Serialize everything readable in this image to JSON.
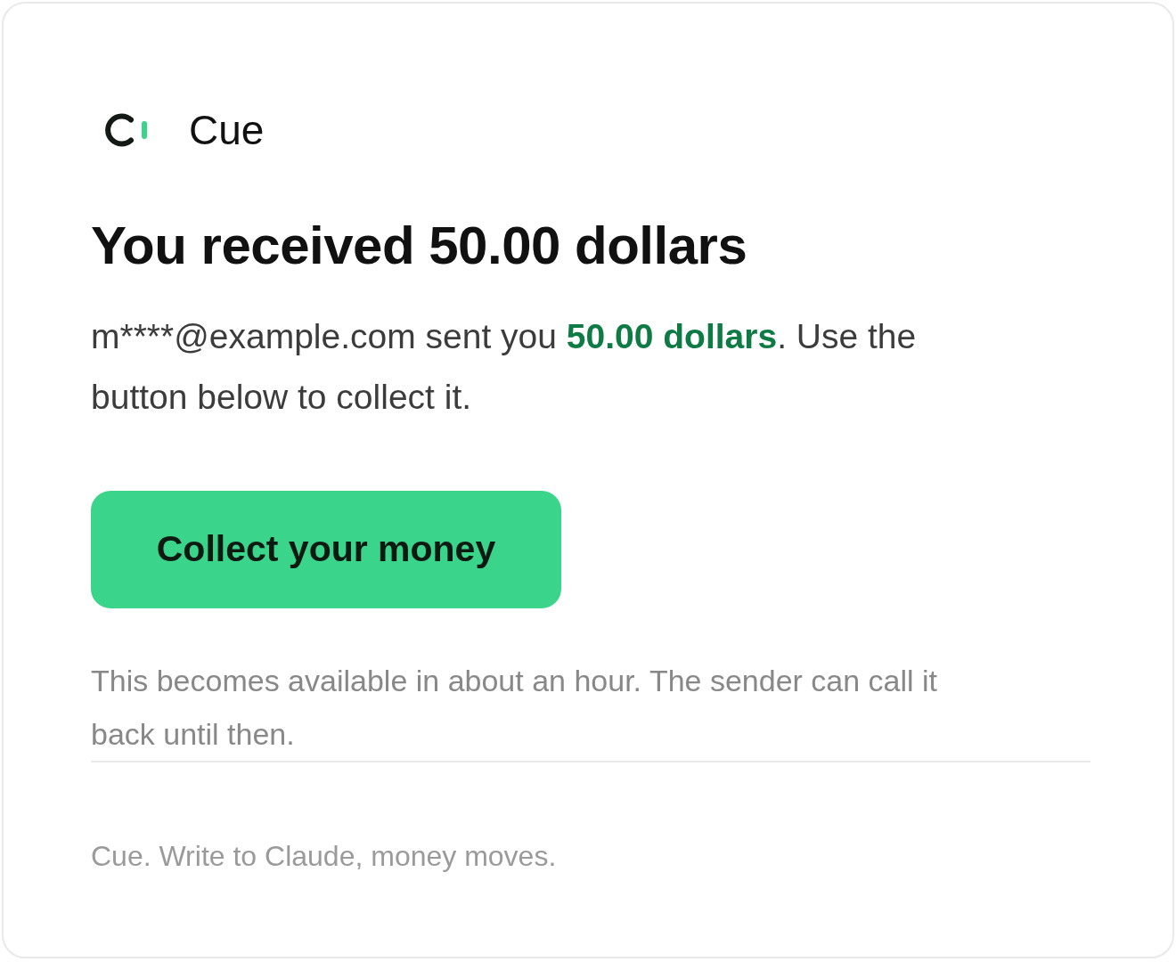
{
  "brand": {
    "name": "Cue"
  },
  "heading": "You received 50.00 dollars",
  "message": [
    {
      "text": "m****@example.com sent you ",
      "bold": false
    },
    {
      "text": "50.00 dollars",
      "bold": true
    },
    {
      "text": ". Use the button below to collect it.",
      "bold": false
    }
  ],
  "button": {
    "label": "Collect your money"
  },
  "note": "This becomes available in about an hour. The sender can call it back until then.",
  "footer": "Cue. Write to Claude, money moves."
}
